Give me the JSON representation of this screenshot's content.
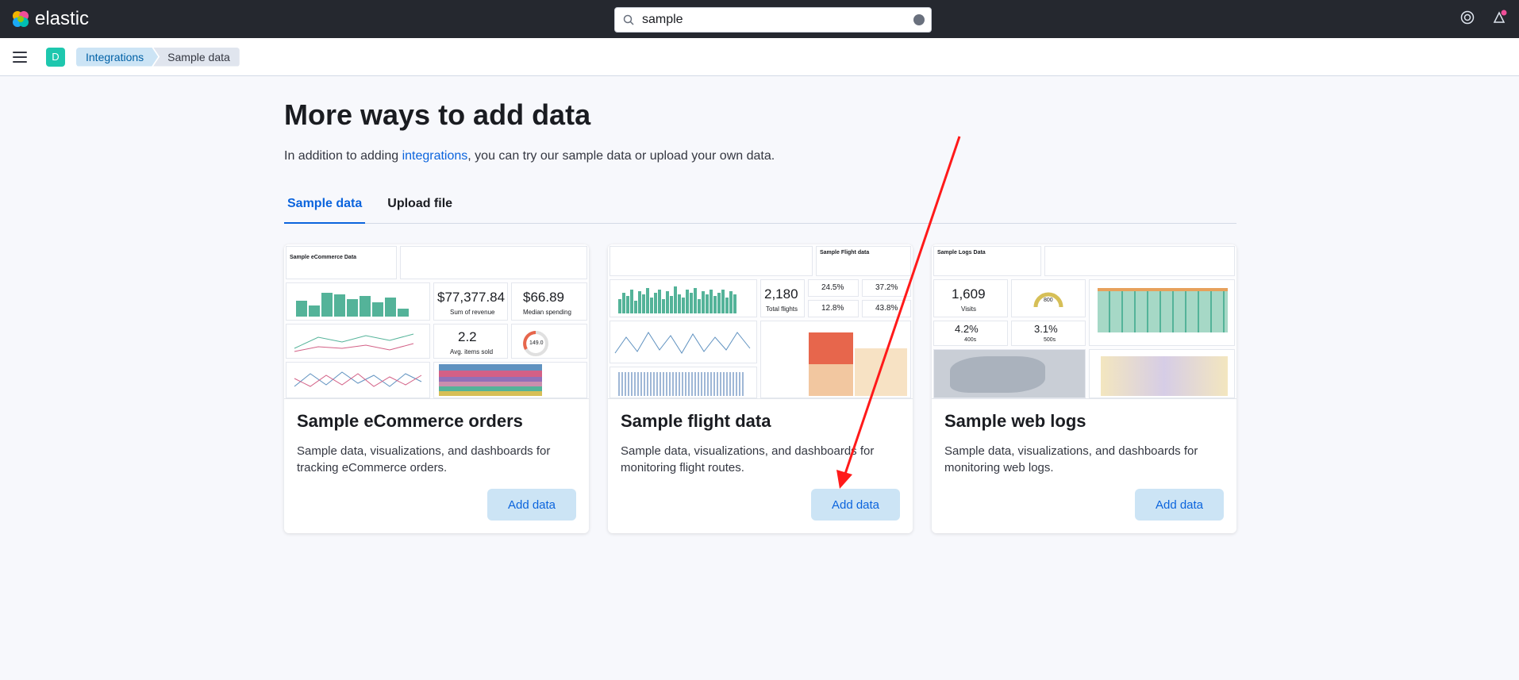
{
  "brand": {
    "name": "elastic"
  },
  "search": {
    "value": "sample"
  },
  "breadcrumbs": [
    "Integrations",
    "Sample data"
  ],
  "space": {
    "initial": "D"
  },
  "page": {
    "title": "More ways to add data",
    "intro_before": "In addition to adding ",
    "intro_link": "integrations",
    "intro_after": ", you can try our sample data or upload your own data."
  },
  "tabs": [
    {
      "label": "Sample data",
      "active": true
    },
    {
      "label": "Upload file",
      "active": false
    }
  ],
  "cards": [
    {
      "title": "Sample eCommerce orders",
      "description": "Sample data, visualizations, and dashboards for tracking eCommerce orders.",
      "button": "Add data",
      "thumb": {
        "stat1": "$77,377.84",
        "stat1_label": "Sum of revenue",
        "stat2": "$66.89",
        "stat2_label": "Median spending",
        "stat3": "2.2",
        "stat3_label": "Avg. items sold",
        "gauge": "149.0",
        "heading": "Sample eCommerce Data"
      }
    },
    {
      "title": "Sample flight data",
      "description": "Sample data, visualizations, and dashboards for monitoring flight routes.",
      "button": "Add data",
      "thumb": {
        "stat1": "2,180",
        "stat1_label": "Total flights",
        "p1": "24.5%",
        "p2": "37.2%",
        "p3": "12.8%",
        "p4": "43.8%",
        "heading": "Sample Flight data"
      }
    },
    {
      "title": "Sample web logs",
      "description": "Sample data, visualizations, and dashboards for monitoring web logs.",
      "button": "Add data",
      "thumb": {
        "stat1": "1,609",
        "stat1_label": "Visits",
        "stat2": "4.2%",
        "stat2_label": "400s",
        "stat3": "3.1%",
        "stat3_label": "500s",
        "gauge": "800",
        "heading": "Sample Logs Data"
      }
    }
  ],
  "colors": {
    "topbar": "#25282f",
    "accent": "#0b64dd",
    "button_bg": "#cce4f5",
    "arrow": "#ff1a1a"
  }
}
